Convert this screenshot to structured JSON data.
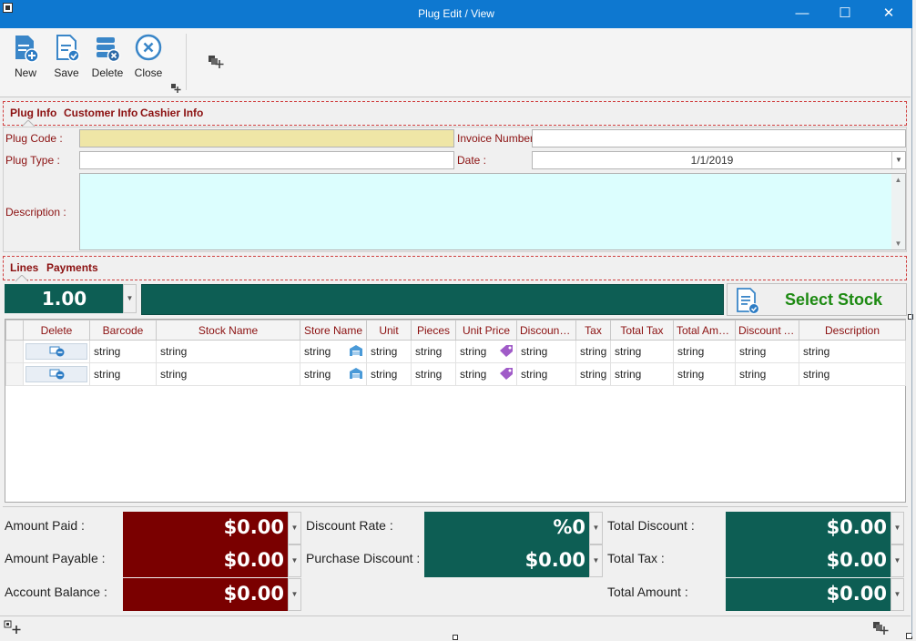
{
  "window": {
    "title": "Plug Edit / View",
    "minimize": "—",
    "maximize": "☐",
    "close": "✕"
  },
  "toolbar": {
    "new_label": "New",
    "save_label": "Save",
    "delete_label": "Delete",
    "close_label": "Close"
  },
  "info_tabs": [
    "Plug Info",
    "Customer Info",
    "Cashier Info"
  ],
  "form": {
    "plug_code_label": "Plug Code :",
    "plug_code_value": "",
    "plug_type_label": "Plug Type :",
    "plug_type_value": "",
    "description_label": "Description :",
    "description_value": "",
    "invoice_number_label": "Invoice Number :",
    "invoice_number_value": "",
    "date_label": "Date :",
    "date_value": "1/1/2019"
  },
  "line_tabs": [
    "Lines",
    "Payments"
  ],
  "quantity_value": "1.00",
  "select_stock_label": "Select Stock",
  "grid": {
    "columns": [
      "Delete",
      "Barcode",
      "Stock Name",
      "Store Name",
      "Unit",
      "Pieces",
      "Unit Price",
      "Discount ...",
      "Tax",
      "Total Tax",
      "Total Amo...",
      "Discount A...",
      "Description"
    ],
    "rows": [
      [
        "",
        "string",
        "string",
        "string",
        "string",
        "string",
        "string",
        "string",
        "string",
        "string",
        "string",
        "string",
        "string"
      ],
      [
        "",
        "string",
        "string",
        "string",
        "string",
        "string",
        "string",
        "string",
        "string",
        "string",
        "string",
        "string",
        "string"
      ]
    ]
  },
  "summary": {
    "amount_paid_label": "Amount Paid :",
    "amount_paid_value": "$0.00",
    "amount_payable_label": "Amount Payable :",
    "amount_payable_value": "$0.00",
    "account_balance_label": "Account Balance :",
    "account_balance_value": "$0.00",
    "discount_rate_label": "Discount Rate :",
    "discount_rate_value": "%0",
    "purchase_discount_label": "Purchase Discount :",
    "purchase_discount_value": "$0.00",
    "total_discount_label": "Total Discount :",
    "total_discount_value": "$0.00",
    "total_tax_label": "Total Tax :",
    "total_tax_value": "$0.00",
    "total_amount_label": "Total Amount :",
    "total_amount_value": "$0.00"
  },
  "colors": {
    "titlebar": "#0e78d0",
    "label_red": "#8b1010",
    "dark_red": "#7a0000",
    "teal": "#0d5e54",
    "plug_code_bg": "#efe6a6",
    "description_bg": "#dcfefe",
    "select_stock_text": "#1d8a12"
  }
}
